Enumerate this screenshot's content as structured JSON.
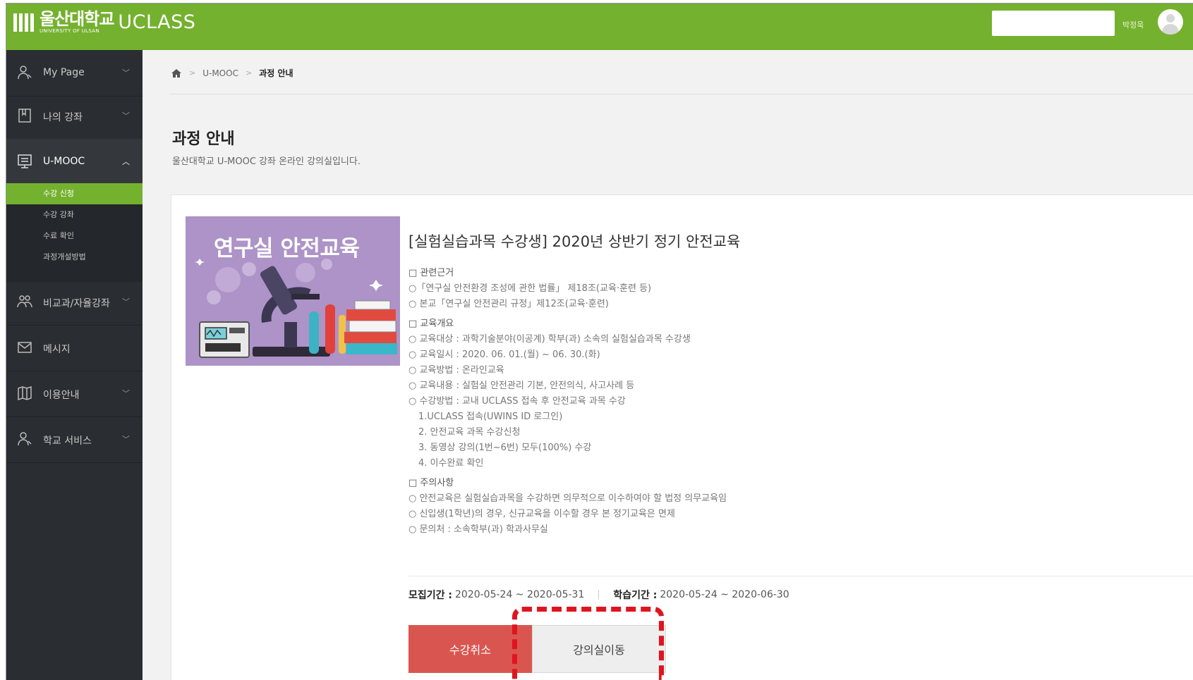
{
  "header": {
    "logo_korean": "울산대학교",
    "logo_english": "UNIVERSITY OF ULSAN",
    "logo_product": "UCLASS",
    "username": "박정욱",
    "brand_color": "#74b12e"
  },
  "sidebar": {
    "items": [
      {
        "label": "My Page",
        "icon": "user-icon"
      },
      {
        "label": "나의 강좌",
        "icon": "book-icon"
      },
      {
        "label": "U-MOOC",
        "icon": "monitor-icon"
      },
      {
        "label": "비교과/자율강좌",
        "icon": "group-icon"
      },
      {
        "label": "메시지",
        "icon": "mail-icon"
      },
      {
        "label": "이용안내",
        "icon": "map-icon"
      },
      {
        "label": "학교 서비스",
        "icon": "user-icon"
      }
    ],
    "submenu": [
      "수강 신청",
      "수강 강좌",
      "수료 확인",
      "과정개설방법"
    ]
  },
  "breadcrumb": {
    "items": [
      "U-MOOC",
      "과정 안내"
    ]
  },
  "page": {
    "title": "과정 안내",
    "subtitle": "울산대학교 U-MOOC 강좌 온라인 강의실입니다."
  },
  "course": {
    "thumbnail_title": "연구실 안전교육",
    "title": "[실험실습과목 수강생] 2020년 상반기 정기 안전교육",
    "sections": [
      {
        "heading": "□ 관련근거",
        "lines": [
          "○「연구실 안전환경 조성에 관한 법률」 제18조(교육·훈련 등)",
          "○ 본교「연구실 안전관리 규정」제12조(교육·훈련)"
        ]
      },
      {
        "heading": "□ 교육개요",
        "lines": [
          "○ 교육대상 : 과학기술분야(이공계) 학부(과) 소속의 실험실습과목 수강생",
          "○ 교육일시 : 2020. 06. 01.(월) ~ 06. 30.(화)",
          "○ 교육방법 : 온라인교육",
          "○ 교육내용 : 실험실 안전관리 기본, 안전의식, 사고사례 등",
          "○ 수강방법 : 교내 UCLASS 접속 후 안전교육 과목 수강"
        ],
        "steps": [
          "1.UCLASS 접속(UWINS ID 로그인)",
          "2. 안전교육 과목 수강신청",
          "3. 동영상 강의(1번~6번) 모두(100%) 수강",
          "4. 이수완료 확인"
        ]
      },
      {
        "heading": "□ 주의사항",
        "lines": [
          "○ 안전교육은 실험실습과목을 수강하면 의무적으로 이수하여야 할 법정 의무교육임",
          "○ 신입생(1학년)의 경우, 신규교육을 이수할 경우 본 정기교육은 면제",
          "○ 문의처 : 소속학부(과) 학과사무실"
        ]
      }
    ],
    "recruit_label": "모집기간 :",
    "recruit_period": "2020-05-24 ~ 2020-05-31",
    "study_label": "학습기간 :",
    "study_period": "2020-05-24 ~ 2020-06-30",
    "cancel_button": "수강취소",
    "classroom_button": "강의실이동"
  },
  "colors": {
    "sidebar_bg": "#2a2d31",
    "cancel_button": "#d95650",
    "highlight": "#e0141f"
  }
}
